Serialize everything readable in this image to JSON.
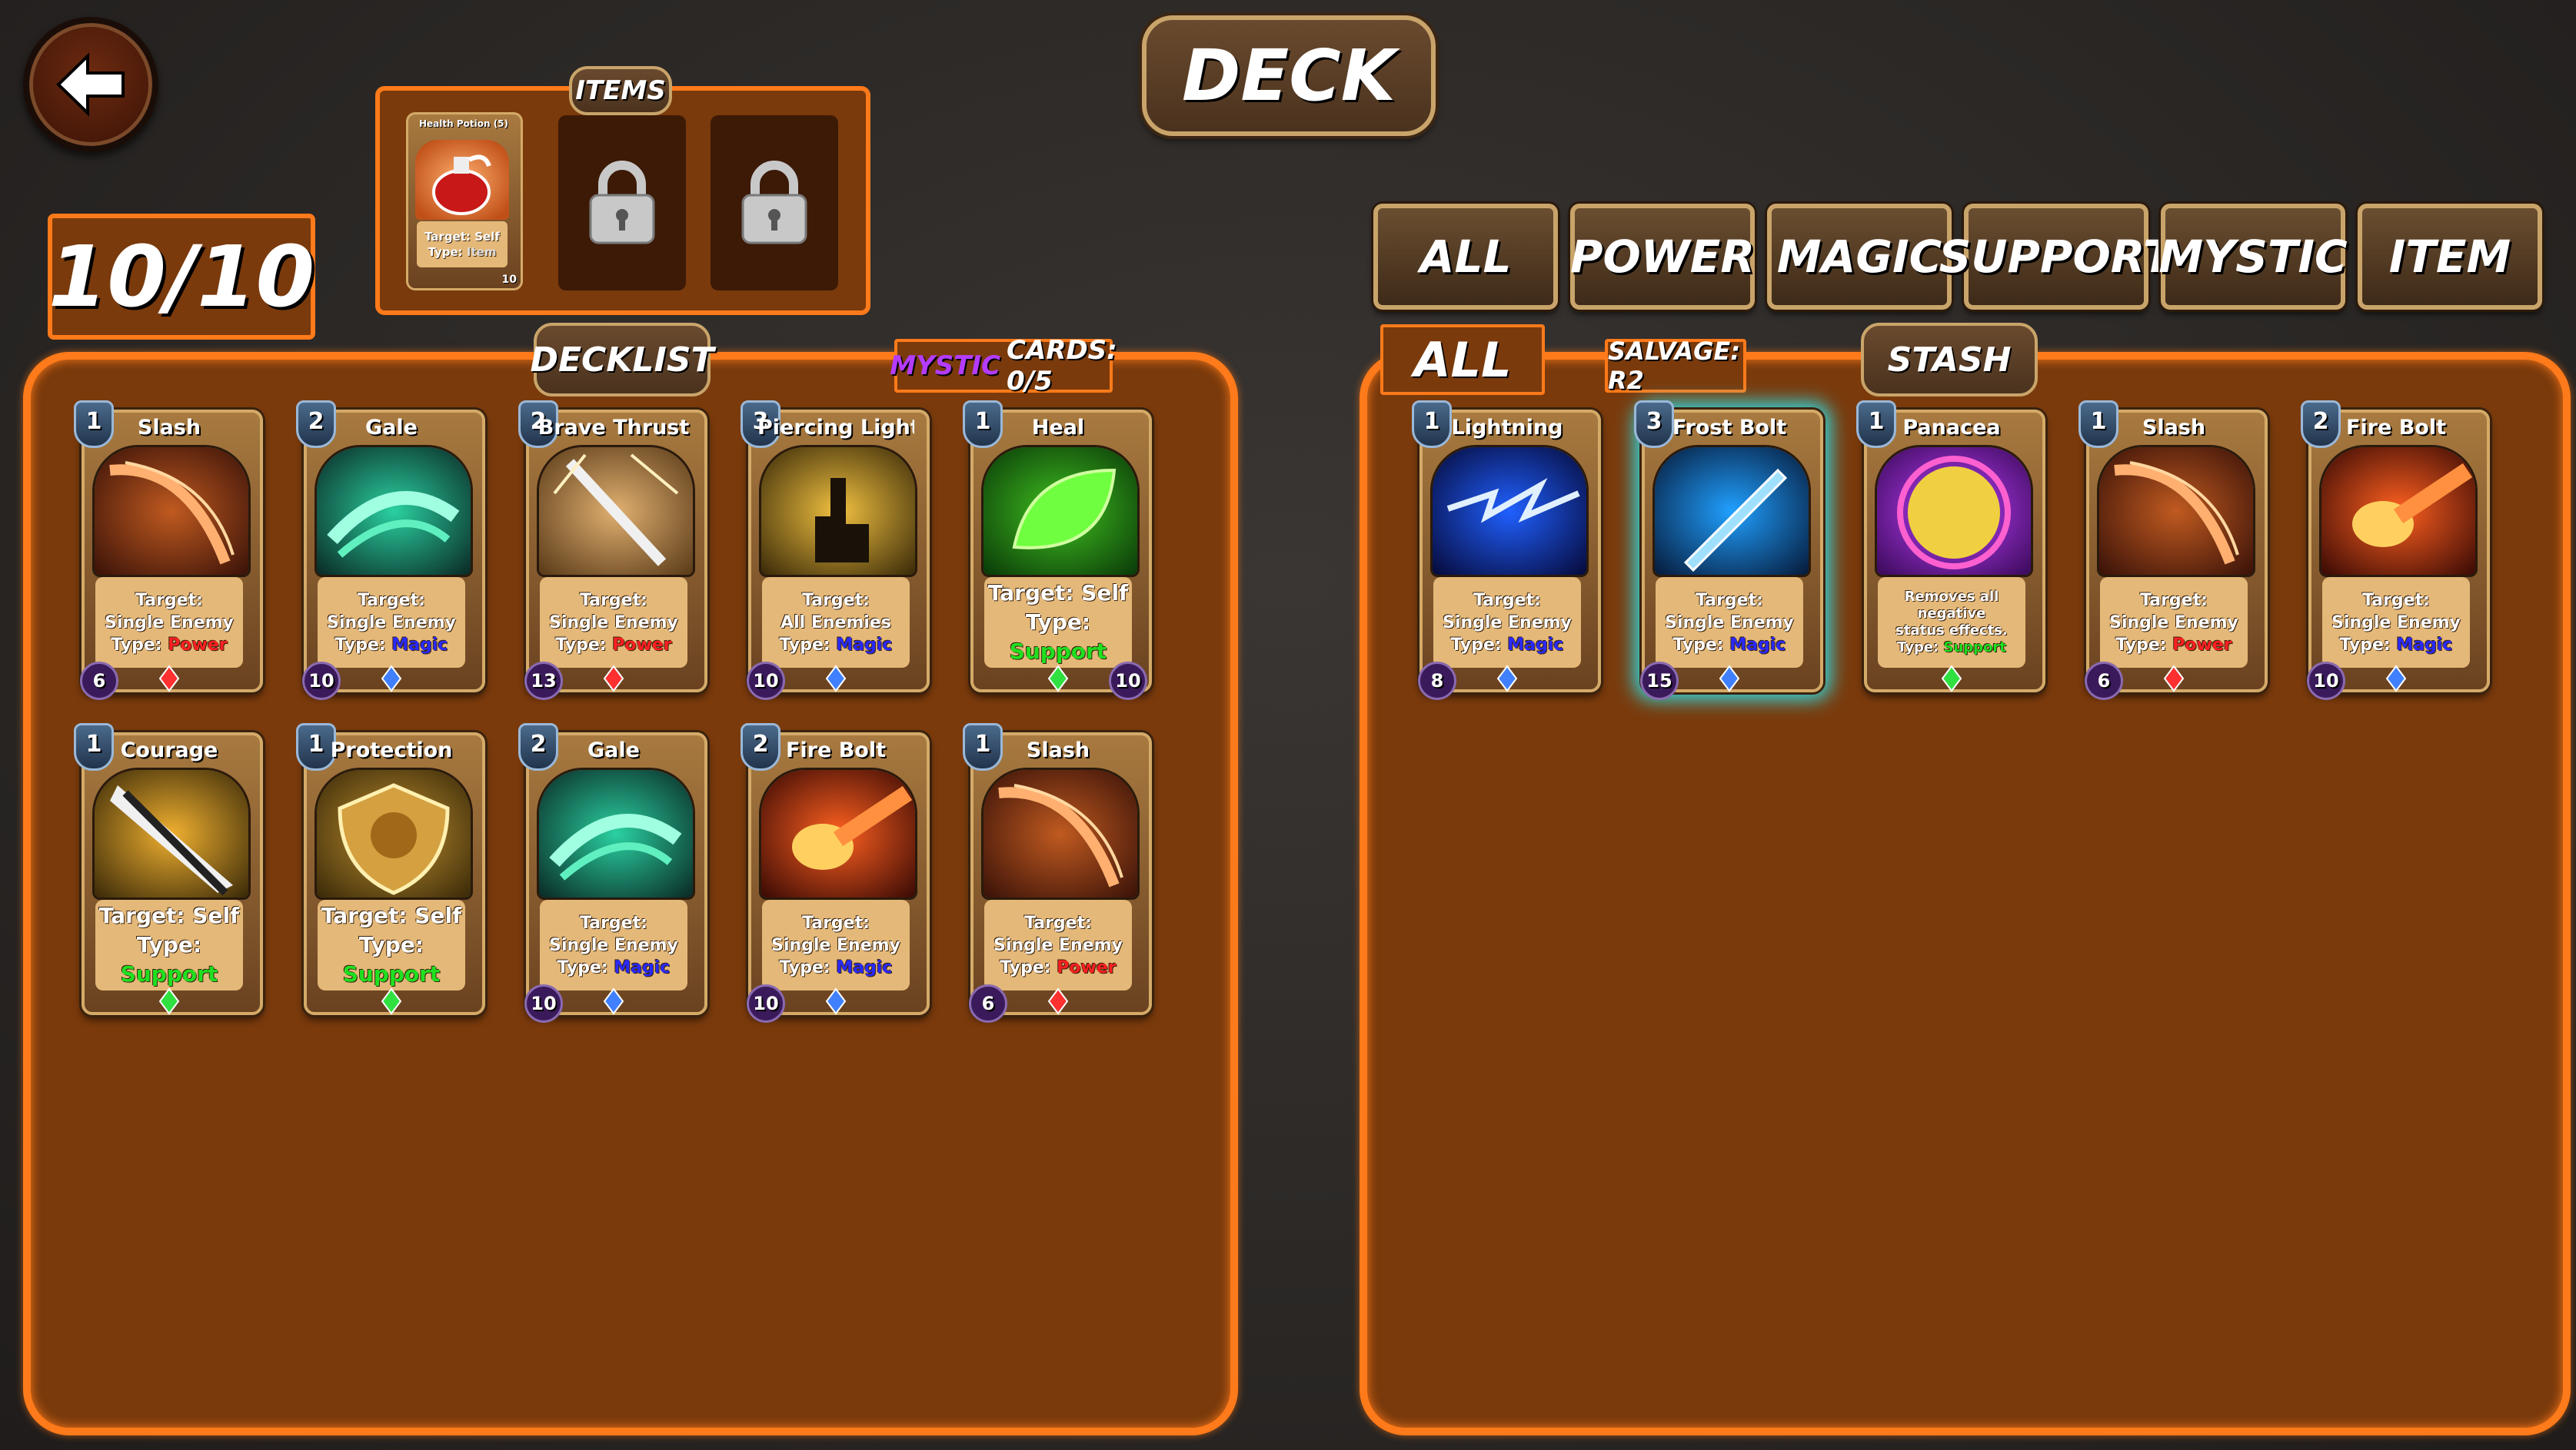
{
  "header": {
    "title": "DECK",
    "back_icon": "back-arrow-icon"
  },
  "deck_count": "10/10",
  "items": {
    "label": "ITEMS",
    "slots": [
      {
        "name": "Health Potion (5)",
        "target": "Target: Self",
        "type_prefix": "Type:",
        "type": "Item",
        "value": "10"
      },
      {
        "locked": true,
        "icon": "lock-icon"
      },
      {
        "locked": true,
        "icon": "lock-icon"
      }
    ]
  },
  "filters": [
    "ALL",
    "POWER",
    "MAGIC",
    "SUPPORT",
    "MYSTIC",
    "ITEM"
  ],
  "decklist": {
    "label": "DECKLIST",
    "mystic_word": "MYSTIC",
    "mystic_rest": "CARDS: 0/5",
    "cards": [
      {
        "cost": "1",
        "name": "Slash",
        "l1": "Target:",
        "l2": "Single Enemy",
        "type": "Power",
        "left": "6",
        "right": ""
      },
      {
        "cost": "2",
        "name": "Gale",
        "l1": "Target:",
        "l2": "Single Enemy",
        "type": "Magic",
        "left": "10",
        "right": ""
      },
      {
        "cost": "2",
        "name": "Brave Thrust",
        "l1": "Target:",
        "l2": "Single Enemy",
        "type": "Power",
        "left": "13",
        "right": ""
      },
      {
        "cost": "3",
        "name": "Piercing Light",
        "l1": "Target:",
        "l2": "All Enemies",
        "type": "Magic",
        "left": "10",
        "right": ""
      },
      {
        "cost": "1",
        "name": "Heal",
        "l1": "Target: Self",
        "l2": "",
        "type": "Support",
        "left": "",
        "right": "10"
      },
      {
        "cost": "1",
        "name": "Courage",
        "l1": "Target: Self",
        "l2": "",
        "type": "Support",
        "left": "",
        "right": ""
      },
      {
        "cost": "1",
        "name": "Protection",
        "l1": "Target: Self",
        "l2": "",
        "type": "Support",
        "left": "",
        "right": ""
      },
      {
        "cost": "2",
        "name": "Gale",
        "l1": "Target:",
        "l2": "Single Enemy",
        "type": "Magic",
        "left": "10",
        "right": ""
      },
      {
        "cost": "2",
        "name": "Fire Bolt",
        "l1": "Target:",
        "l2": "Single Enemy",
        "type": "Magic",
        "left": "10",
        "right": ""
      },
      {
        "cost": "1",
        "name": "Slash",
        "l1": "Target:",
        "l2": "Single Enemy",
        "type": "Power",
        "left": "6",
        "right": ""
      }
    ]
  },
  "stash": {
    "label": "STASH",
    "filter": "ALL",
    "salvage": "SALVAGE: R2",
    "cards": [
      {
        "cost": "1",
        "name": "Lightning",
        "l1": "Target:",
        "l2": "Single Enemy",
        "type": "Magic",
        "left": "8",
        "right": ""
      },
      {
        "cost": "3",
        "name": "Frost Bolt",
        "l1": "Target:",
        "l2": "Single Enemy",
        "type": "Magic",
        "left": "15",
        "right": ""
      },
      {
        "cost": "1",
        "name": "Panacea",
        "l1": "Removes all negative",
        "l2": "status effects.",
        "type": "Support",
        "left": "",
        "right": ""
      },
      {
        "cost": "1",
        "name": "Slash",
        "l1": "Target:",
        "l2": "Single Enemy",
        "type": "Power",
        "left": "6",
        "right": ""
      },
      {
        "cost": "2",
        "name": "Fire Bolt",
        "l1": "Target:",
        "l2": "Single Enemy",
        "type": "Magic",
        "left": "10",
        "right": ""
      }
    ]
  },
  "type_prefix": "Type:"
}
